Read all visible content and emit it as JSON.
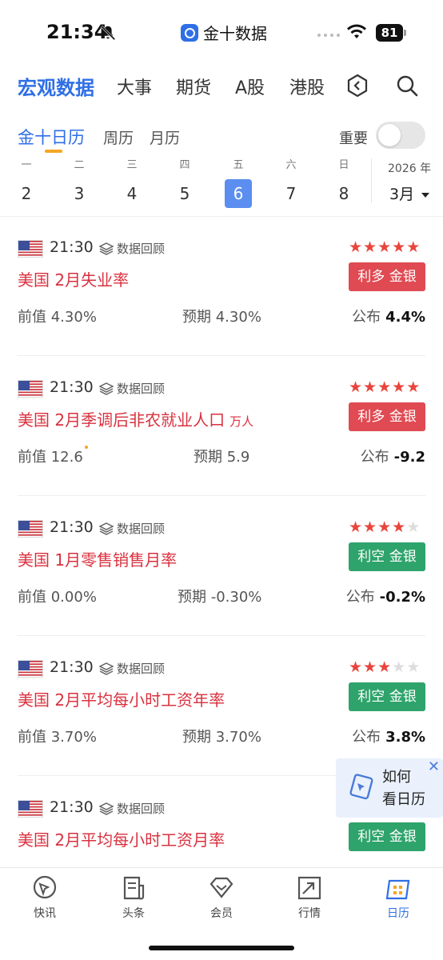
{
  "status_bar": {
    "time": "21:34",
    "app_name": "金十数据",
    "battery": "81"
  },
  "top_nav": {
    "tabs": [
      "宏观数据",
      "大事",
      "期货",
      "A股",
      "港股"
    ],
    "active_index": 0
  },
  "sub_tabs": {
    "tabs": [
      "金十日历",
      "周历",
      "月历"
    ],
    "active_index": 0,
    "important_label": "重要",
    "important_on": false
  },
  "week": {
    "days": [
      {
        "weekday": "一",
        "date": "2"
      },
      {
        "weekday": "二",
        "date": "3"
      },
      {
        "weekday": "三",
        "date": "4"
      },
      {
        "weekday": "四",
        "date": "5"
      },
      {
        "weekday": "五",
        "date": "6"
      },
      {
        "weekday": "六",
        "date": "7"
      },
      {
        "weekday": "日",
        "date": "8"
      }
    ],
    "selected_index": 4,
    "year": "2026 年",
    "month": "3月"
  },
  "review_label": "数据回顾",
  "events": [
    {
      "time": "21:30",
      "title": "美国 2月失业率",
      "unit": "",
      "stars": 5,
      "badge": "利多 金银",
      "badge_color": "#e04a52",
      "prev_label": "前值",
      "prev": "4.30%",
      "exp_label": "预期",
      "exp": "4.30%",
      "act_label": "公布",
      "act": "4.4%",
      "revised": false
    },
    {
      "time": "21:30",
      "title": "美国 2月季调后非农就业人口",
      "unit": "万人",
      "stars": 5,
      "badge": "利多 金银",
      "badge_color": "#e04a52",
      "prev_label": "前值",
      "prev": "12.6",
      "exp_label": "预期",
      "exp": "5.9",
      "act_label": "公布",
      "act": "-9.2",
      "revised": true
    },
    {
      "time": "21:30",
      "title": "美国 1月零售销售月率",
      "unit": "",
      "stars": 4,
      "badge": "利空 金银",
      "badge_color": "#2ea36b",
      "prev_label": "前值",
      "prev": "0.00%",
      "exp_label": "预期",
      "exp": "-0.30%",
      "act_label": "公布",
      "act": "-0.2%",
      "revised": false
    },
    {
      "time": "21:30",
      "title": "美国 2月平均每小时工资年率",
      "unit": "",
      "stars": 3,
      "badge": "利空 金银",
      "badge_color": "#2ea36b",
      "prev_label": "前值",
      "prev": "3.70%",
      "exp_label": "预期",
      "exp": "3.70%",
      "act_label": "公布",
      "act": "3.8%",
      "revised": false
    },
    {
      "time": "21:30",
      "title": "美国 2月平均每小时工资月率",
      "unit": "",
      "stars": 0,
      "badge": "利空 金银",
      "badge_color": "#2ea36b",
      "prev_label": "",
      "prev": "",
      "exp_label": "",
      "exp": "",
      "act_label": "",
      "act": "",
      "revised": false
    }
  ],
  "float_tip": {
    "line1": "如何",
    "line2": "看日历"
  },
  "bottom_nav": {
    "items": [
      "快讯",
      "头条",
      "会员",
      "行情",
      "日历"
    ],
    "active_index": 4
  }
}
